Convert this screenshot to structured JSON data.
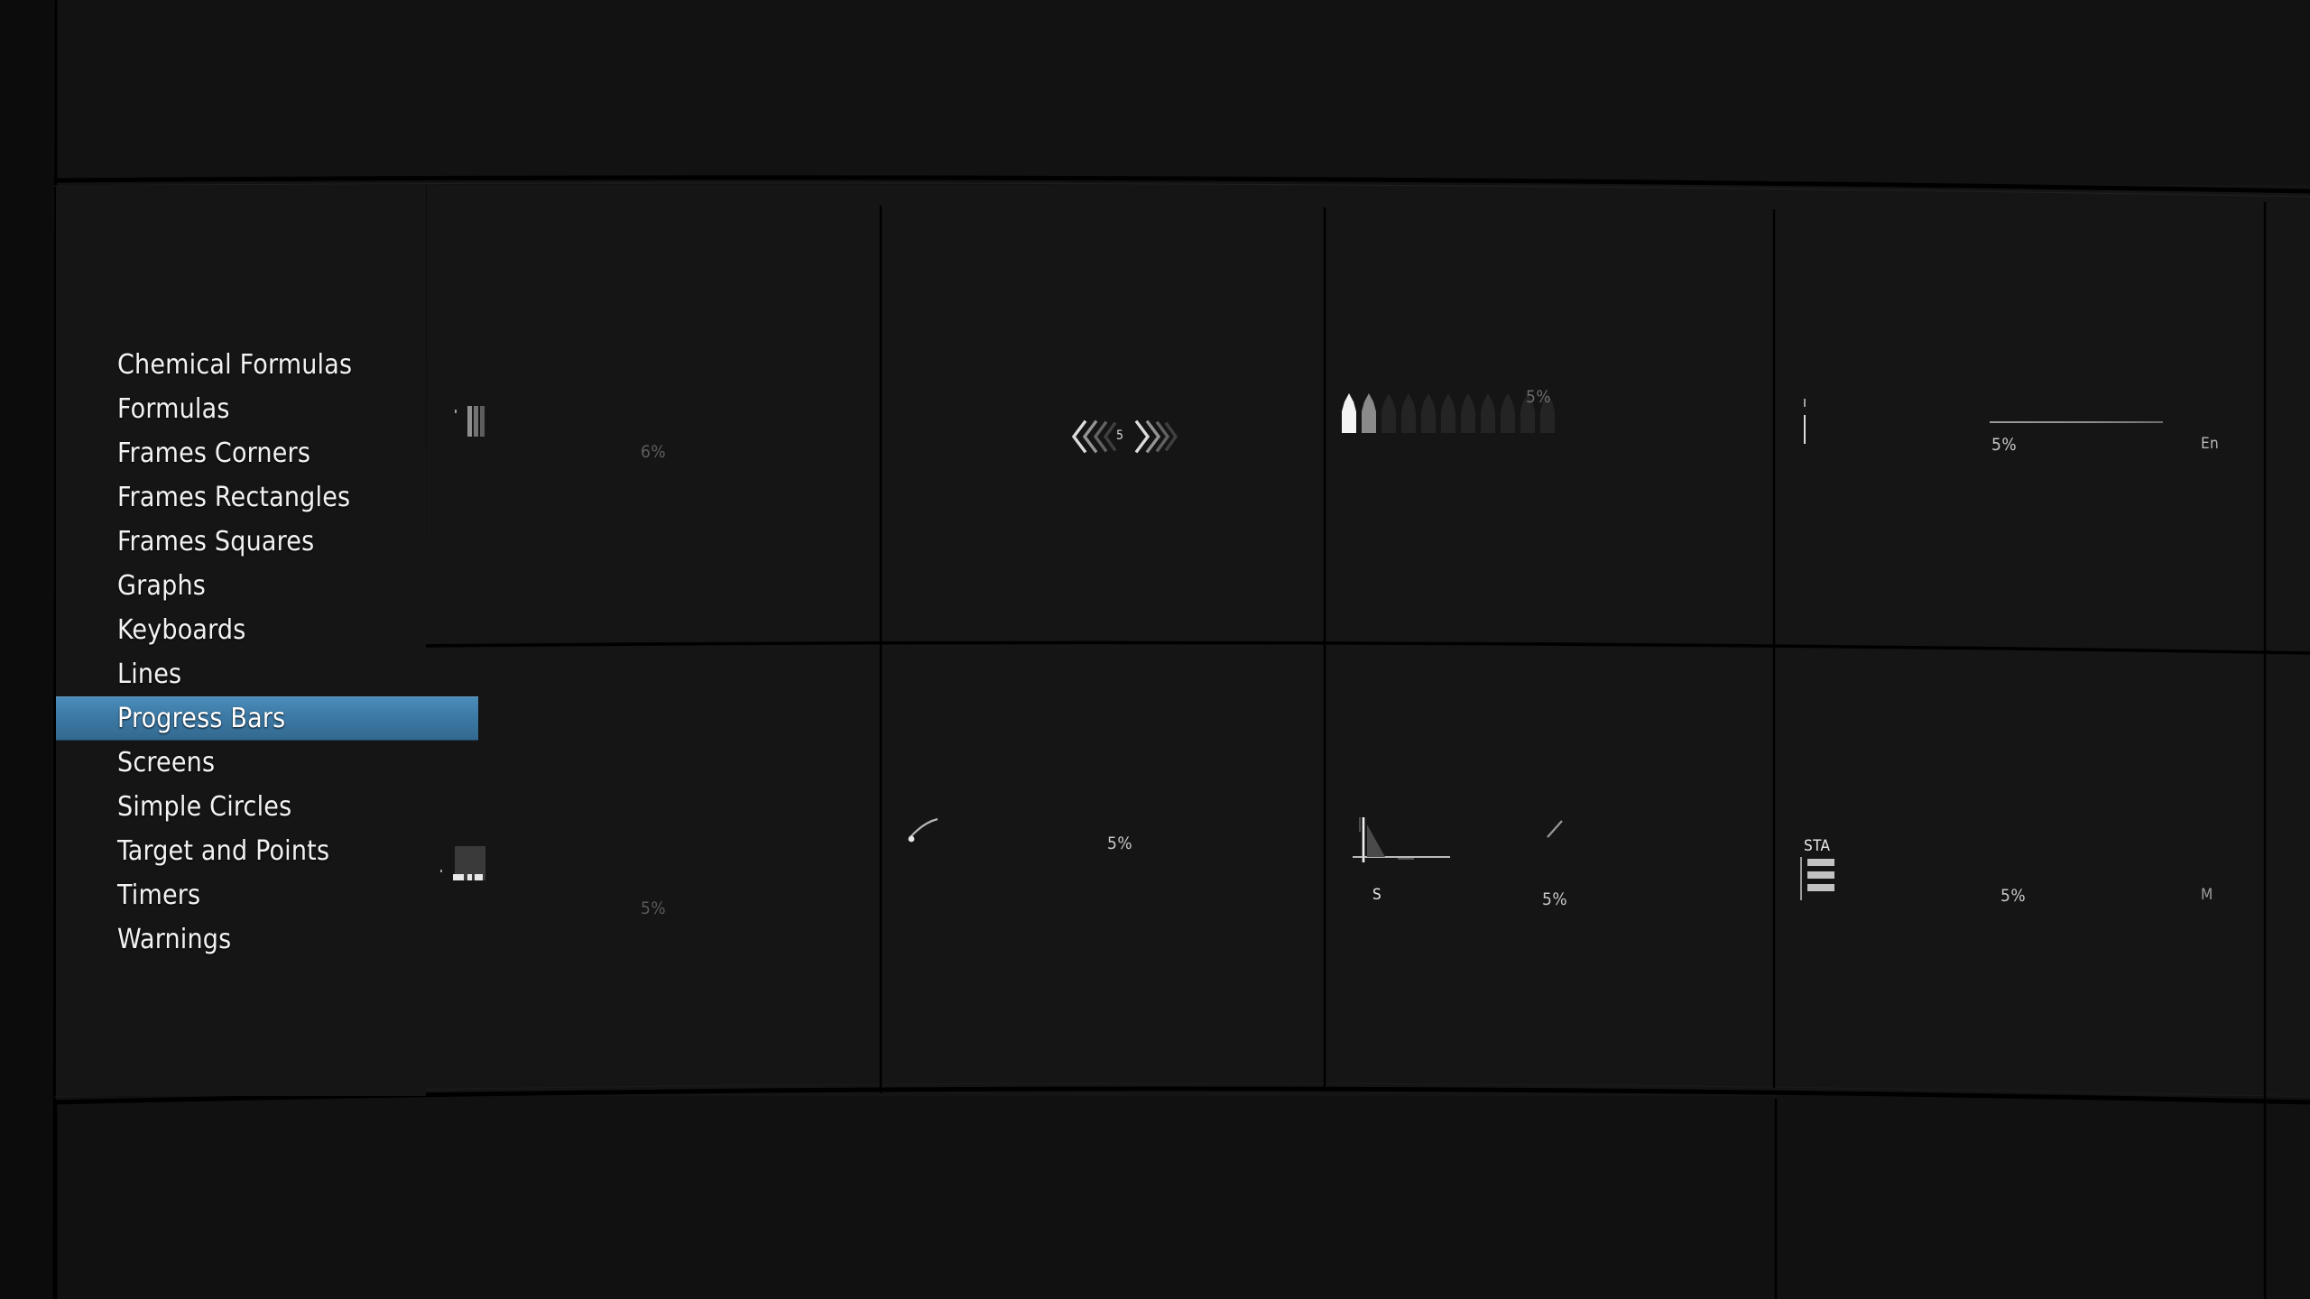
{
  "app": {
    "selected_category": "Progress Bars",
    "accent_color": "#3d7aa6",
    "background_color": "#141414"
  },
  "sidebar": {
    "items": [
      {
        "label": "Chemical Formulas",
        "selected": false
      },
      {
        "label": "Formulas",
        "selected": false
      },
      {
        "label": "Frames Corners",
        "selected": false
      },
      {
        "label": "Frames Rectangles",
        "selected": false
      },
      {
        "label": "Frames Squares",
        "selected": false
      },
      {
        "label": "Graphs",
        "selected": false
      },
      {
        "label": "Keyboards",
        "selected": false
      },
      {
        "label": "Lines",
        "selected": false
      },
      {
        "label": "Progress Bars",
        "selected": true
      },
      {
        "label": "Screens",
        "selected": false
      },
      {
        "label": "Simple Circles",
        "selected": false
      },
      {
        "label": "Target and Points",
        "selected": false
      },
      {
        "label": "Timers",
        "selected": false
      },
      {
        "label": "Warnings",
        "selected": false
      }
    ]
  },
  "previews": {
    "cell1": {
      "percent": "6%",
      "widget": "segmented-vertical-block"
    },
    "cell2": {
      "value": "5",
      "widget": "dual-chevron-meter"
    },
    "cell3": {
      "percent": "5%",
      "widget": "bullet-magazine",
      "bullets_total": 11,
      "bullets_full": 1,
      "bullets_half": 1
    },
    "cell4": {
      "percent": "5%",
      "label": "En",
      "widget": "thin-line-track"
    },
    "cell5": {
      "percent": "5%",
      "widget": "block-with-lit-segments"
    },
    "cell6": {
      "percent": "5%",
      "widget": "arc-dot-indicator"
    },
    "cell7": {
      "percent": "5%",
      "label": "S",
      "widget": "axis-spike-graph"
    },
    "cell8": {
      "percent": "5%",
      "label": "STA",
      "label_right": "M",
      "widget": "stacked-status-bars"
    }
  }
}
